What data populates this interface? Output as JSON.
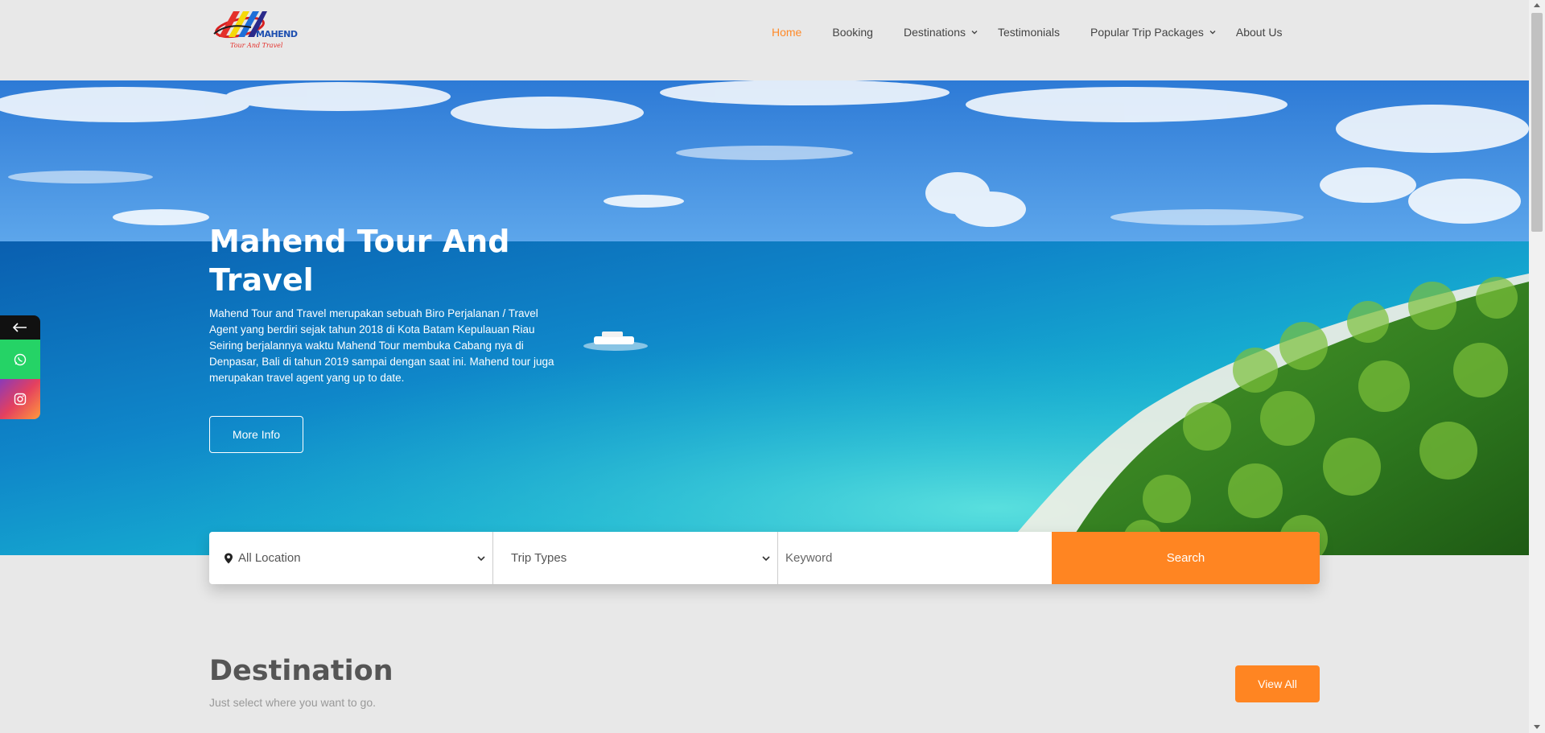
{
  "header": {
    "logo_text": "MAHEND",
    "logo_tagline": "Tour And Travel",
    "nav": [
      {
        "label": "Home",
        "active": true
      },
      {
        "label": "Booking"
      },
      {
        "label": "Destinations",
        "has_dropdown": true
      },
      {
        "label": "Testimonials"
      },
      {
        "label": "Popular Trip Packages",
        "has_dropdown": true
      },
      {
        "label": "About Us"
      }
    ]
  },
  "hero": {
    "title": "Mahend Tour And Travel",
    "description": "Mahend Tour and Travel merupakan sebuah Biro Perjalanan / Travel Agent yang berdiri sejak tahun 2018 di Kota Batam Kepulauan Riau Seiring berjalannya waktu Mahend Tour membuka Cabang nya di Denpasar, Bali di tahun 2019 sampai dengan saat ini. Mahend tour juga merupakan travel agent yang up to date.",
    "more_info_label": "More Info"
  },
  "social": {
    "back_icon": "arrow-left-icon",
    "whatsapp_icon": "whatsapp-icon",
    "instagram_icon": "instagram-icon"
  },
  "search": {
    "location_value": "All Location",
    "trip_types_value": "Trip Types",
    "keyword_placeholder": "Keyword",
    "search_label": "Search"
  },
  "destination": {
    "title": "Destination",
    "subtitle": "Just select where you want to go.",
    "view_all_label": "View All"
  },
  "colors": {
    "accent": "#ff8522",
    "nav_active": "#ff8a29",
    "background": "#e8e8e8",
    "whatsapp": "#25d366"
  }
}
